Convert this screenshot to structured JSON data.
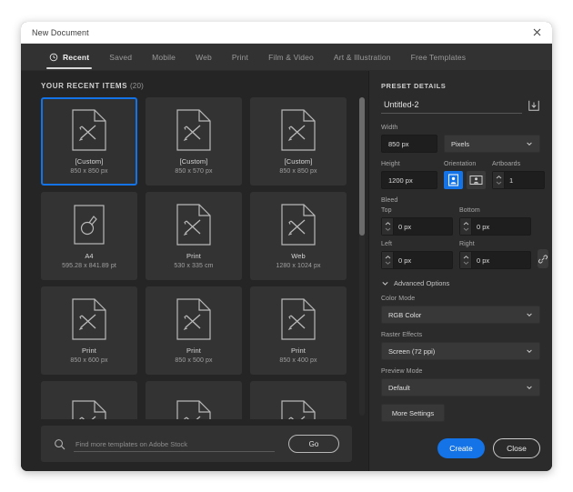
{
  "window": {
    "title": "New Document",
    "close_icon": "close-icon"
  },
  "tabs": [
    {
      "label": "Recent",
      "icon": "clock-icon",
      "active": true
    },
    {
      "label": "Saved",
      "active": false
    },
    {
      "label": "Mobile",
      "active": false
    },
    {
      "label": "Web",
      "active": false
    },
    {
      "label": "Print",
      "active": false
    },
    {
      "label": "Film & Video",
      "active": false
    },
    {
      "label": "Art & Illustration",
      "active": false
    },
    {
      "label": "Free Templates",
      "active": false
    }
  ],
  "recent": {
    "heading": "YOUR RECENT ITEMS",
    "count": "(20)",
    "items": [
      {
        "title": "[Custom]",
        "size": "850 x 850 px",
        "icon": "document-pencil-icon",
        "selected": true
      },
      {
        "title": "[Custom]",
        "size": "850 x 570 px",
        "icon": "document-pencil-icon",
        "selected": false
      },
      {
        "title": "[Custom]",
        "size": "850 x 850 px",
        "icon": "document-pencil-icon",
        "selected": false
      },
      {
        "title": "A4",
        "size": "595.28 x 841.89 pt",
        "icon": "artboard-shape-icon",
        "selected": false
      },
      {
        "title": "Print",
        "size": "530 x 335 cm",
        "icon": "document-pencil-icon",
        "selected": false
      },
      {
        "title": "Web",
        "size": "1280 x 1024 px",
        "icon": "document-pencil-icon",
        "selected": false
      },
      {
        "title": "Print",
        "size": "850 x 600 px",
        "icon": "document-pencil-icon",
        "selected": false
      },
      {
        "title": "Print",
        "size": "850 x 500 px",
        "icon": "document-pencil-icon",
        "selected": false
      },
      {
        "title": "Print",
        "size": "850 x 400 px",
        "icon": "document-pencil-icon",
        "selected": false
      },
      {
        "title": "",
        "size": "",
        "icon": "document-pencil-icon",
        "selected": false
      },
      {
        "title": "",
        "size": "",
        "icon": "document-pencil-icon",
        "selected": false
      },
      {
        "title": "",
        "size": "",
        "icon": "document-pencil-icon",
        "selected": false
      }
    ]
  },
  "stock": {
    "search_icon": "search-icon",
    "placeholder": "Find more templates on Adobe Stock",
    "value": "",
    "go_label": "Go"
  },
  "preset": {
    "heading": "PRESET DETAILS",
    "name_value": "Untitled-2",
    "save_preset_icon": "save-preset-icon",
    "width_label": "Width",
    "width_value": "850 px",
    "units_value": "Pixels",
    "height_label": "Height",
    "height_value": "1200 px",
    "orientation_label": "Orientation",
    "orientation_portrait_icon": "orientation-portrait-icon",
    "orientation_landscape_icon": "orientation-landscape-icon",
    "artboards_label": "Artboards",
    "artboards_value": "1",
    "bleed_label": "Bleed",
    "bleed_top_label": "Top",
    "bleed_top_value": "0 px",
    "bleed_bottom_label": "Bottom",
    "bleed_bottom_value": "0 px",
    "bleed_left_label": "Left",
    "bleed_left_value": "0 px",
    "bleed_right_label": "Right",
    "bleed_right_value": "0 px",
    "bleed_link_icon": "link-icon",
    "advanced_label": "Advanced Options",
    "color_mode_label": "Color Mode",
    "color_mode_value": "RGB Color",
    "raster_label": "Raster Effects",
    "raster_value": "Screen (72 ppi)",
    "preview_label": "Preview Mode",
    "preview_value": "Default",
    "more_settings_label": "More Settings",
    "create_label": "Create",
    "close_label": "Close"
  },
  "colors": {
    "accent": "#1473e6",
    "window_bg": "#252525",
    "panel_bg": "#2b2b2b",
    "card_bg": "#333333",
    "titlebar_bg": "#ffffff"
  }
}
